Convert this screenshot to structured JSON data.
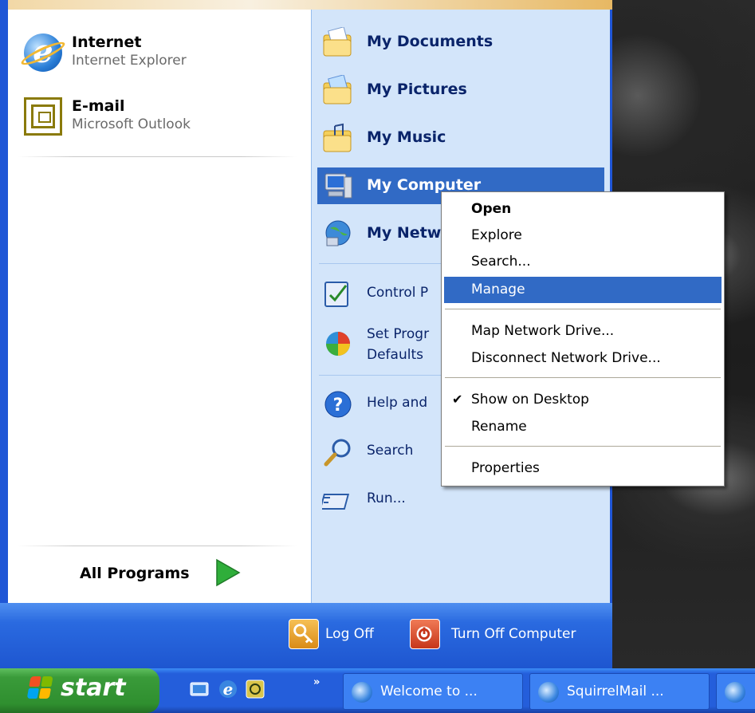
{
  "start_menu": {
    "pinned": [
      {
        "title": "Internet",
        "subtitle": "Internet Explorer",
        "icon": "internet-explorer-icon"
      },
      {
        "title": "E-mail",
        "subtitle": "Microsoft Outlook",
        "icon": "outlook-icon"
      }
    ],
    "all_programs_label": "All Programs",
    "right_items": [
      {
        "label": "My Documents",
        "icon": "my-documents-icon"
      },
      {
        "label": "My Pictures",
        "icon": "my-pictures-icon"
      },
      {
        "label": "My Music",
        "icon": "my-music-icon"
      },
      {
        "label": "My Computer",
        "icon": "my-computer-icon"
      },
      {
        "label": "My Netw",
        "icon": "my-network-places-icon"
      },
      {
        "label": "Control P",
        "icon": "control-panel-icon"
      },
      {
        "label": "Set Progr",
        "label2": "Defaults",
        "icon": "set-program-access-icon"
      },
      {
        "label": "Help and",
        "icon": "help-icon"
      },
      {
        "label": "Search",
        "icon": "search-icon"
      },
      {
        "label": "Run...",
        "icon": "run-icon"
      }
    ],
    "log_off_label": "Log Off",
    "turn_off_label": "Turn Off Computer"
  },
  "context_menu": {
    "items": [
      {
        "label": "Open",
        "bold": true
      },
      {
        "label": "Explore"
      },
      {
        "label": "Search..."
      },
      {
        "label": "Manage",
        "selected": true
      },
      {
        "label": "Map Network Drive..."
      },
      {
        "label": "Disconnect Network Drive..."
      },
      {
        "label": "Show on Desktop",
        "checked": true
      },
      {
        "label": "Rename"
      },
      {
        "label": "Properties"
      }
    ]
  },
  "taskbar": {
    "start_label": "start",
    "quick_launch": [
      "show-desktop-icon",
      "internet-explorer-icon",
      "media-player-icon"
    ],
    "buttons": [
      {
        "label": "Welcome to ..."
      },
      {
        "label": "SquirrelMail ..."
      }
    ]
  },
  "colors": {
    "menu_blue": "#1f56d6",
    "right_pane": "#d3e5fa",
    "highlight": "#316ac5",
    "start_green": "#3a9b3a"
  }
}
